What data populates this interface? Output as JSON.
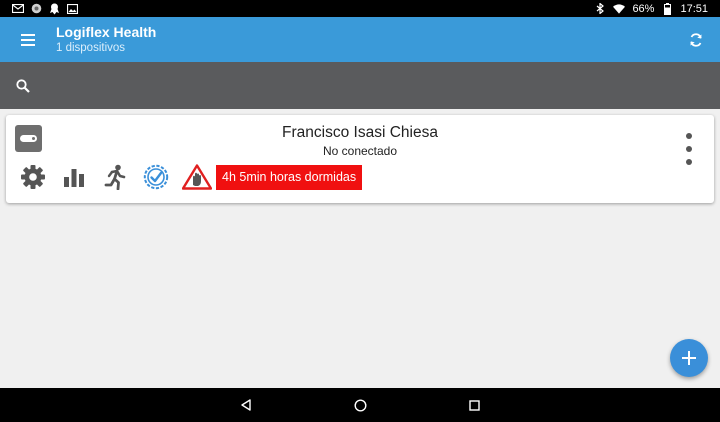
{
  "status_bar": {
    "battery": "66%",
    "time": "17:51",
    "left_icons": [
      "gmail-icon",
      "circle-app-icon",
      "ghost-icon",
      "image-icon"
    ],
    "right_icons": [
      "bluetooth-icon",
      "wifi-icon",
      "battery-icon"
    ]
  },
  "app_bar": {
    "title": "Logiflex Health",
    "subtitle": "1 dispositivos",
    "menu_icon": "hamburger-menu-icon",
    "refresh_icon": "refresh-icon"
  },
  "search": {
    "icon": "search-icon"
  },
  "device_card": {
    "name": "Francisco Isasi Chiesa",
    "status": "No conectado",
    "alert_text": "4h 5min horas dormidas",
    "actions": [
      "gear-icon",
      "bar-chart-icon",
      "running-person-icon",
      "check-badge-icon",
      "warning-hand-icon"
    ],
    "colors": {
      "alert_bg": "#f01010",
      "check_blue": "#3a8fd9",
      "warning_red": "#e02020"
    }
  },
  "fab": {
    "icon": "plus-icon",
    "color": "#3a8fd9"
  },
  "colors": {
    "app_bar": "#3a9ad9",
    "search_bar": "#5a5b5d",
    "background": "#f0f0f0"
  }
}
